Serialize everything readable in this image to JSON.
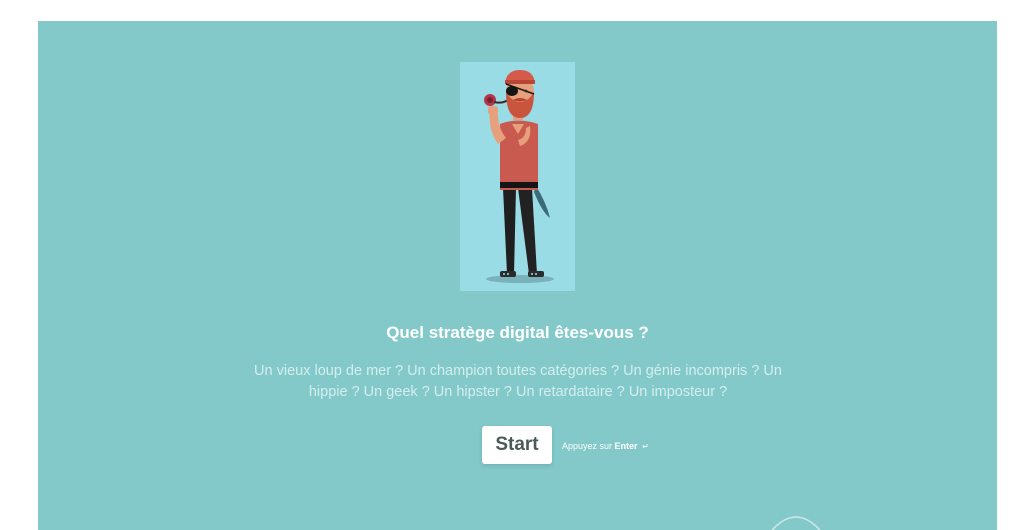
{
  "theme": {
    "panel_bg": "#83c9ca",
    "illustration_bg": "#9adce6",
    "desc_color": "#d4eeee"
  },
  "intro": {
    "title": "Quel stratège digital êtes-vous ?",
    "description": "Un vieux loup de mer ? Un champion toutes catégories ? Un génie incompris ? Un hippie ? Un geek ? Un hipster ? Un retardataire ? Un imposteur ?",
    "start_label": "Start",
    "hint_prefix": "Appuyez sur",
    "hint_key": "Enter",
    "hint_icon": "enter-return-icon"
  }
}
